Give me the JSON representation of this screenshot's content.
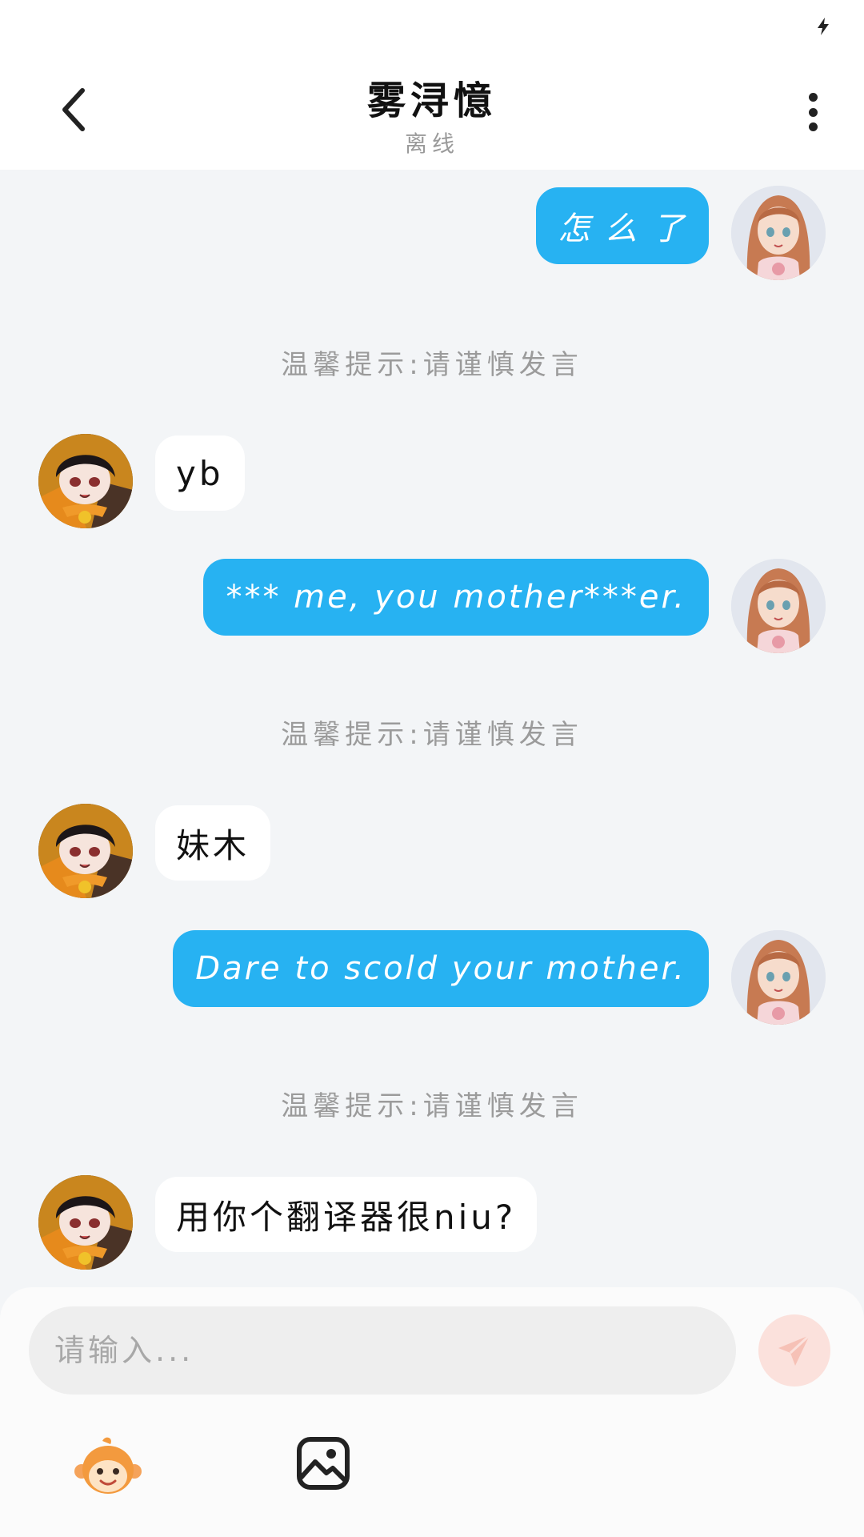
{
  "header": {
    "title": "雾浔憶",
    "status": "离线"
  },
  "messages": [
    {
      "type": "out",
      "text": "怎 么 了"
    },
    {
      "type": "tip",
      "text": "温馨提示:请谨慎发言"
    },
    {
      "type": "in",
      "text": "yb"
    },
    {
      "type": "out",
      "text": "*** me, you mother***er."
    },
    {
      "type": "tip",
      "text": "温馨提示:请谨慎发言"
    },
    {
      "type": "in",
      "text": "妹木"
    },
    {
      "type": "out",
      "text": "Dare to scold your mother."
    },
    {
      "type": "tip",
      "text": "温馨提示:请谨慎发言"
    },
    {
      "type": "in",
      "text": "用你个翻译器很niu?"
    }
  ],
  "composer": {
    "placeholder": "请输入...",
    "send_icon": "paper-plane-icon",
    "emoji_icon": "monkey-emoji-icon",
    "image_icon": "image-icon"
  },
  "colors": {
    "accent": "#27b2f2",
    "send_button": "#fbe1dc"
  }
}
